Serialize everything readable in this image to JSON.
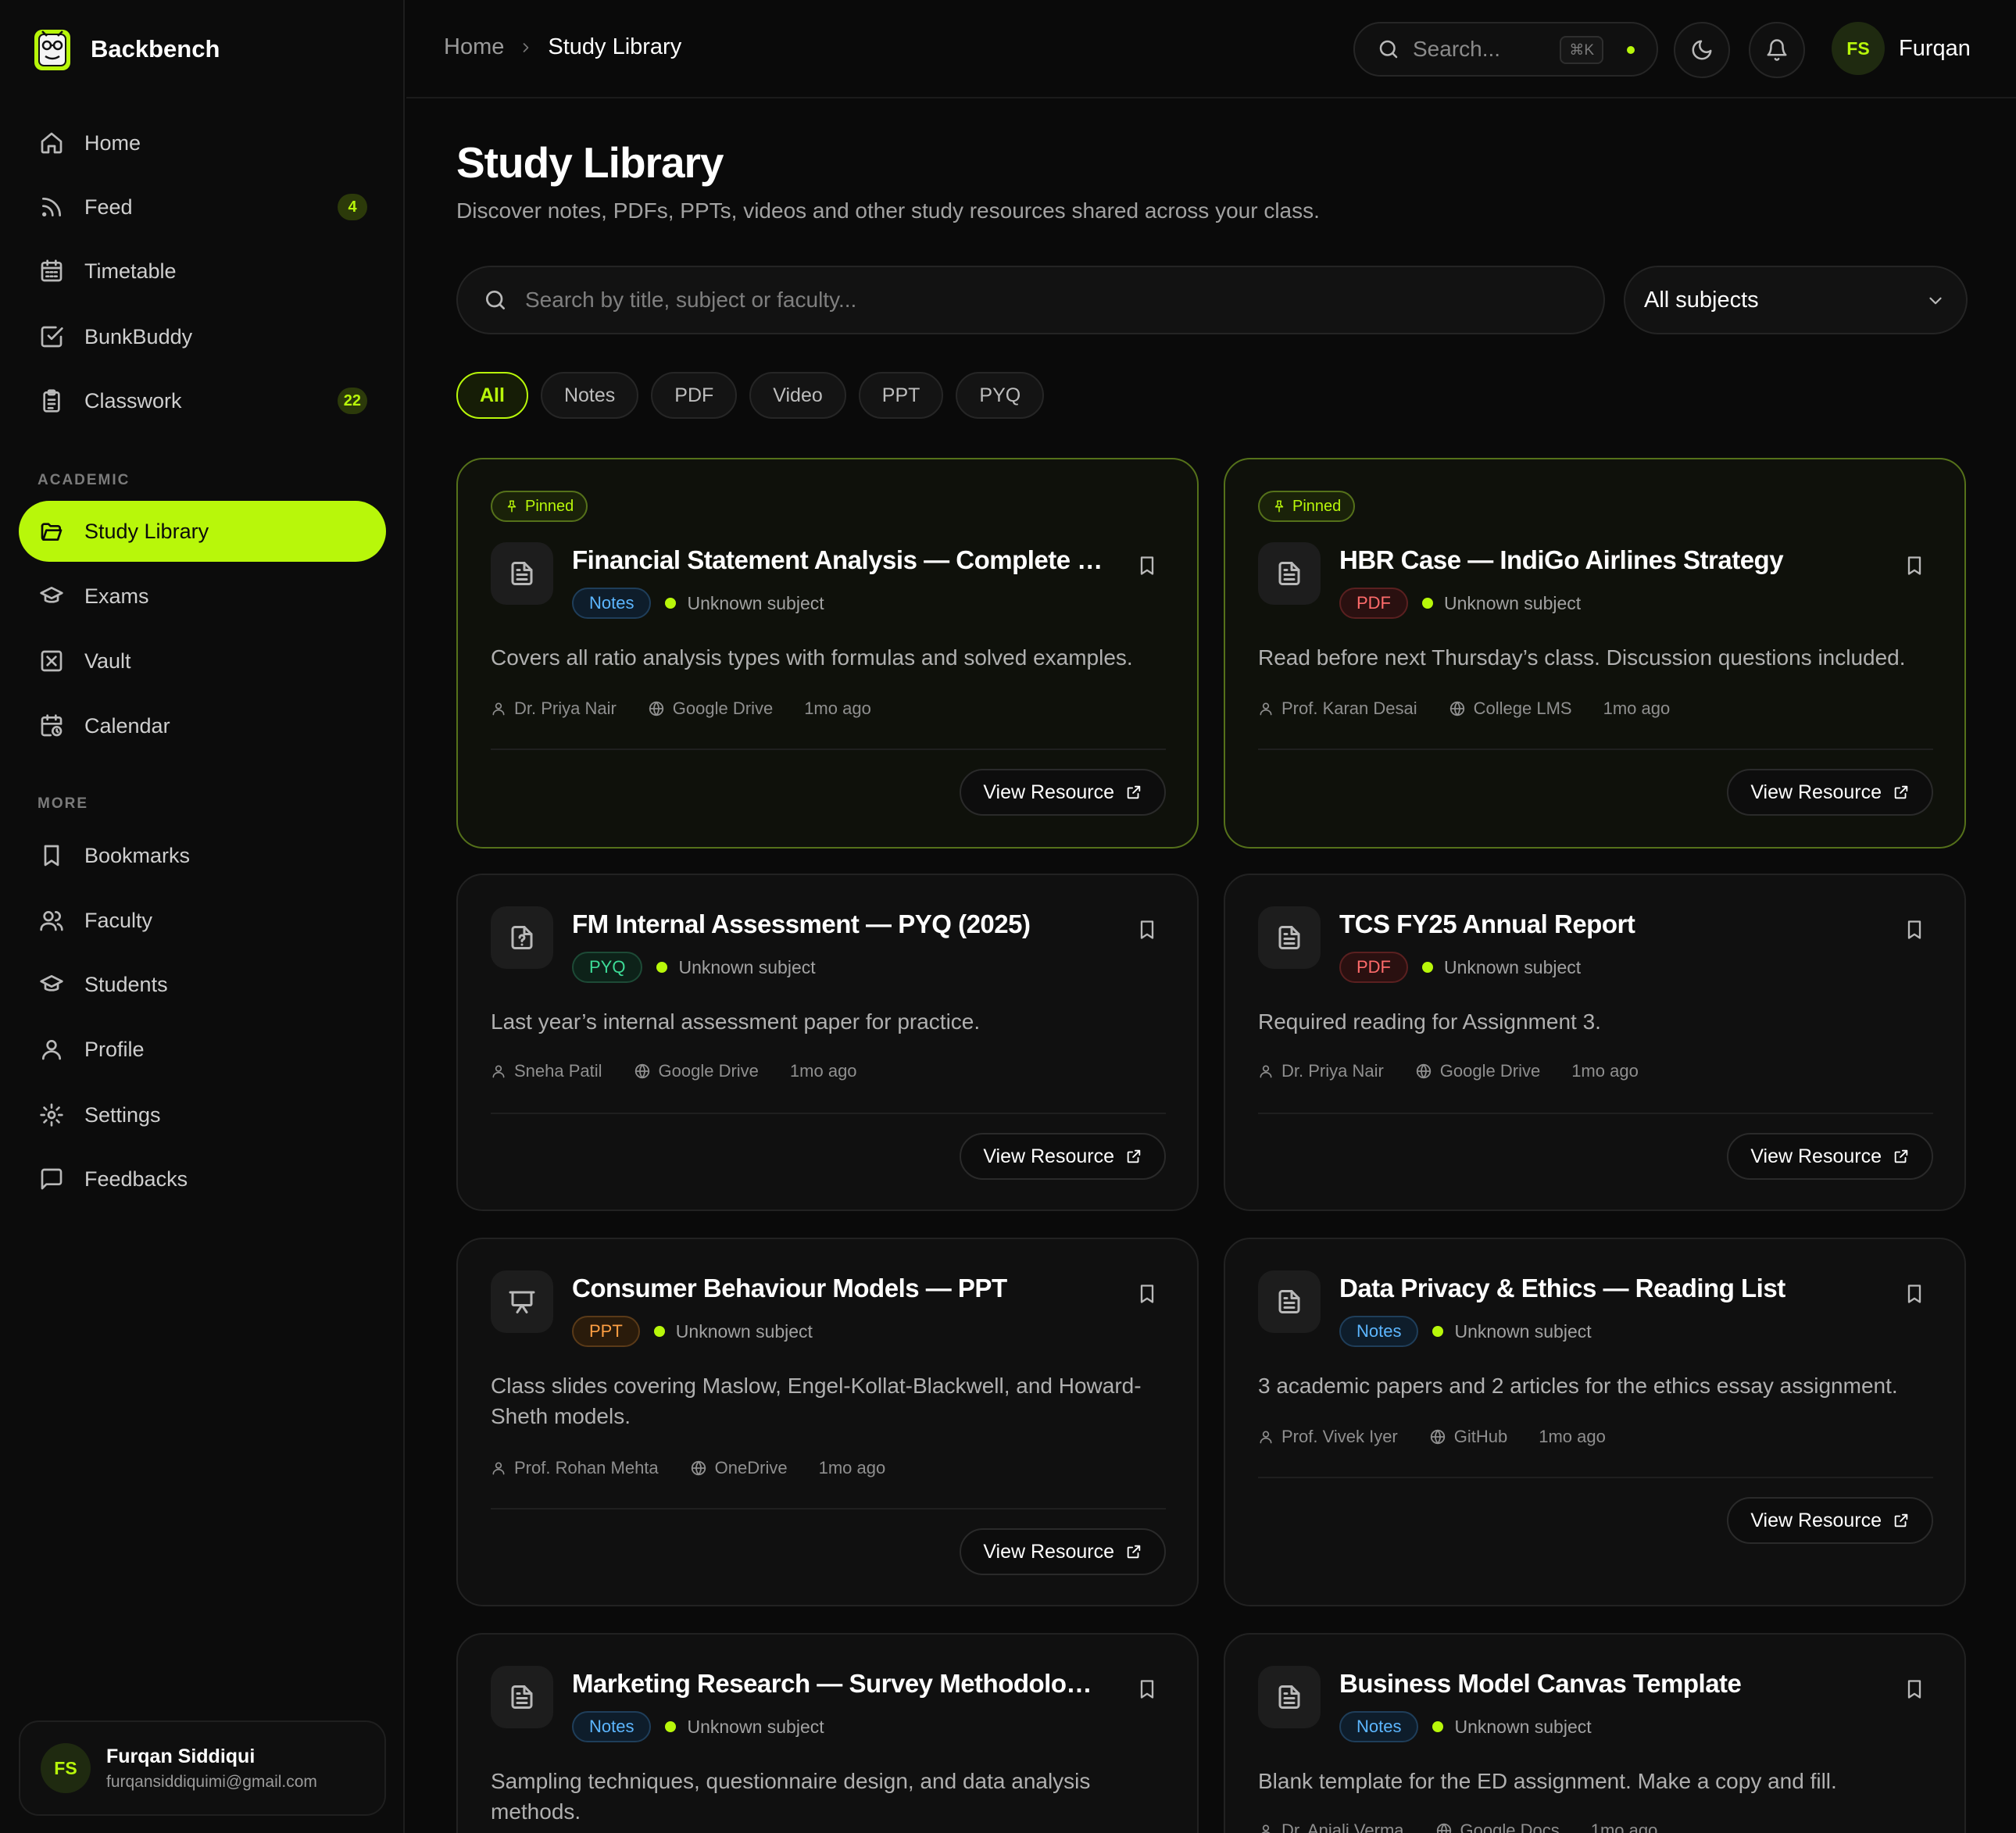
{
  "brand": {
    "name": "Backbench"
  },
  "sidebar": {
    "main": [
      {
        "label": "Home",
        "icon": "home-icon"
      },
      {
        "label": "Feed",
        "icon": "rss-icon",
        "badge": "4"
      },
      {
        "label": "Timetable",
        "icon": "calendar-grid-icon"
      },
      {
        "label": "BunkBuddy",
        "icon": "check-square-icon"
      },
      {
        "label": "Classwork",
        "icon": "clipboard-icon",
        "badge": "22"
      }
    ],
    "academic_label": "ACADEMIC",
    "academic": [
      {
        "label": "Study Library",
        "icon": "folder-open-icon",
        "active": true
      },
      {
        "label": "Exams",
        "icon": "graduation-cap-icon"
      },
      {
        "label": "Vault",
        "icon": "x-square-icon"
      },
      {
        "label": "Calendar",
        "icon": "calendar-clock-icon"
      }
    ],
    "more_label": "MORE",
    "more": [
      {
        "label": "Bookmarks",
        "icon": "bookmark-icon"
      },
      {
        "label": "Faculty",
        "icon": "users-icon"
      },
      {
        "label": "Students",
        "icon": "graduation-cap-icon"
      },
      {
        "label": "Profile",
        "icon": "user-icon"
      },
      {
        "label": "Settings",
        "icon": "gear-icon"
      },
      {
        "label": "Feedbacks",
        "icon": "message-square-icon"
      }
    ],
    "user": {
      "initials": "FS",
      "name": "Furqan Siddiqui",
      "email": "furqansiddiquimi@gmail.com"
    }
  },
  "topbar": {
    "breadcrumb": {
      "home": "Home",
      "current": "Study Library"
    },
    "search_placeholder": "Search...",
    "shortcut": "⌘K",
    "user": {
      "initials": "FS",
      "name": "Furqan"
    }
  },
  "main": {
    "title": "Study Library",
    "subtitle": "Discover notes, PDFs, PPTs, videos and other study resources shared across your class.",
    "search_placeholder": "Search by title, subject or faculty...",
    "subject_filter": "All subjects",
    "filters": [
      {
        "label": "All",
        "active": true
      },
      {
        "label": "Notes"
      },
      {
        "label": "PDF"
      },
      {
        "label": "Video"
      },
      {
        "label": "PPT"
      },
      {
        "label": "PYQ"
      }
    ],
    "pinned_label": "Pinned",
    "view_label": "View Resource",
    "resources": [
      {
        "title": "Financial Statement Analysis — Complete Notes",
        "type": "Notes",
        "subject": "Unknown subject",
        "description": "Covers all ratio analysis types with formulas and solved examples.",
        "author": "Dr. Priya Nair",
        "source": "Google Drive",
        "time": "1mo ago",
        "pinned": true
      },
      {
        "title": "HBR Case — IndiGo Airlines Strategy",
        "type": "PDF",
        "subject": "Unknown subject",
        "description": "Read before next Thursday’s class. Discussion questions included.",
        "author": "Prof. Karan Desai",
        "source": "College LMS",
        "time": "1mo ago",
        "pinned": true
      },
      {
        "title": "FM Internal Assessment — PYQ (2025)",
        "type": "PYQ",
        "subject": "Unknown subject",
        "description": "Last year’s internal assessment paper for practice.",
        "author": "Sneha Patil",
        "source": "Google Drive",
        "time": "1mo ago"
      },
      {
        "title": "TCS FY25 Annual Report",
        "type": "PDF",
        "subject": "Unknown subject",
        "description": "Required reading for Assignment 3.",
        "author": "Dr. Priya Nair",
        "source": "Google Drive",
        "time": "1mo ago"
      },
      {
        "title": "Consumer Behaviour Models — PPT",
        "type": "PPT",
        "subject": "Unknown subject",
        "description": "Class slides covering Maslow, Engel-Kollat-Blackwell, and Howard-Sheth models.",
        "author": "Prof. Rohan Mehta",
        "source": "OneDrive",
        "time": "1mo ago"
      },
      {
        "title": "Data Privacy & Ethics — Reading List",
        "type": "Notes",
        "subject": "Unknown subject",
        "description": "3 academic papers and 2 articles for the ethics essay assignment.",
        "author": "Prof. Vivek Iyer",
        "source": "GitHub",
        "time": "1mo ago"
      },
      {
        "title": "Marketing Research — Survey Methodology Notes",
        "type": "Notes",
        "subject": "Unknown subject",
        "description": "Sampling techniques, questionnaire design, and data analysis methods.",
        "author": "",
        "source": "",
        "time": ""
      },
      {
        "title": "Business Model Canvas Template",
        "type": "Notes",
        "subject": "Unknown subject",
        "description": "Blank template for the ED assignment. Make a copy and fill.",
        "author": "Dr. Anjali Verma",
        "source": "Google Docs",
        "time": "1mo ago"
      }
    ]
  },
  "colors": {
    "accent": "#b8f70a",
    "background": "#0a0a0a",
    "card": "#101010"
  }
}
